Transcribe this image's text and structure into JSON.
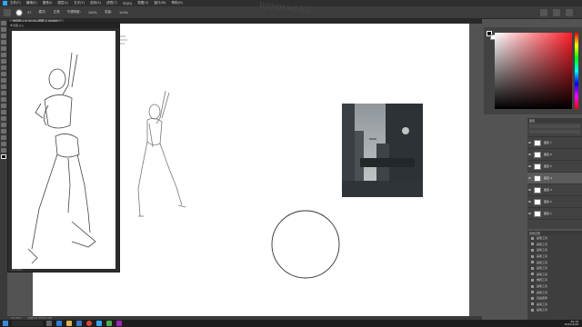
{
  "app": {
    "menu_items": [
      "文件(F)",
      "编辑(E)",
      "图像(I)",
      "图层(L)",
      "文字(Y)",
      "选择(S)",
      "滤镜(T)",
      "3D(D)",
      "视图(V)",
      "窗口(W)",
      "帮助(H)"
    ]
  },
  "options": {
    "brush_size": "57",
    "mode_label": "模式:",
    "mode_value": "正常",
    "opacity_label": "不透明度:",
    "opacity_value": "100%",
    "flow_label": "流量:",
    "flow_value": "100%"
  },
  "handwriting": "ppppswhh2",
  "tab": {
    "label": "未标题-1 @ 33.3% (图层 1, RGB/8) *"
  },
  "reference_window": {
    "title": "参考图.jpg",
    "footer": "33.33%"
  },
  "layers": {
    "panel_title": "图层",
    "items": [
      {
        "name": "图层 7",
        "active": false
      },
      {
        "name": "图层 6",
        "active": false
      },
      {
        "name": "图层 5",
        "active": false
      },
      {
        "name": "图层 4",
        "active": true
      },
      {
        "name": "图层 3",
        "active": false
      },
      {
        "name": "图层 2",
        "active": false
      },
      {
        "name": "图层 1",
        "active": false
      },
      {
        "name": "背景",
        "active": false
      }
    ]
  },
  "actions": {
    "panel_title": "历史记录",
    "items": [
      "画笔工具",
      "画笔工具",
      "画笔工具",
      "画笔工具",
      "画笔工具",
      "画笔工具",
      "画笔工具",
      "椭圆工具",
      "画笔工具",
      "画笔工具",
      "自由变换",
      "画笔工具",
      "画笔工具"
    ]
  },
  "status": {
    "zoom": "33.33%",
    "doc": "文档:25.3M/52.0M"
  },
  "taskbar": {
    "time": "20:18",
    "date": "2020/3/28"
  },
  "colors": {
    "accent": "#31a8ff",
    "hue_pick": "#ff1e2a"
  }
}
